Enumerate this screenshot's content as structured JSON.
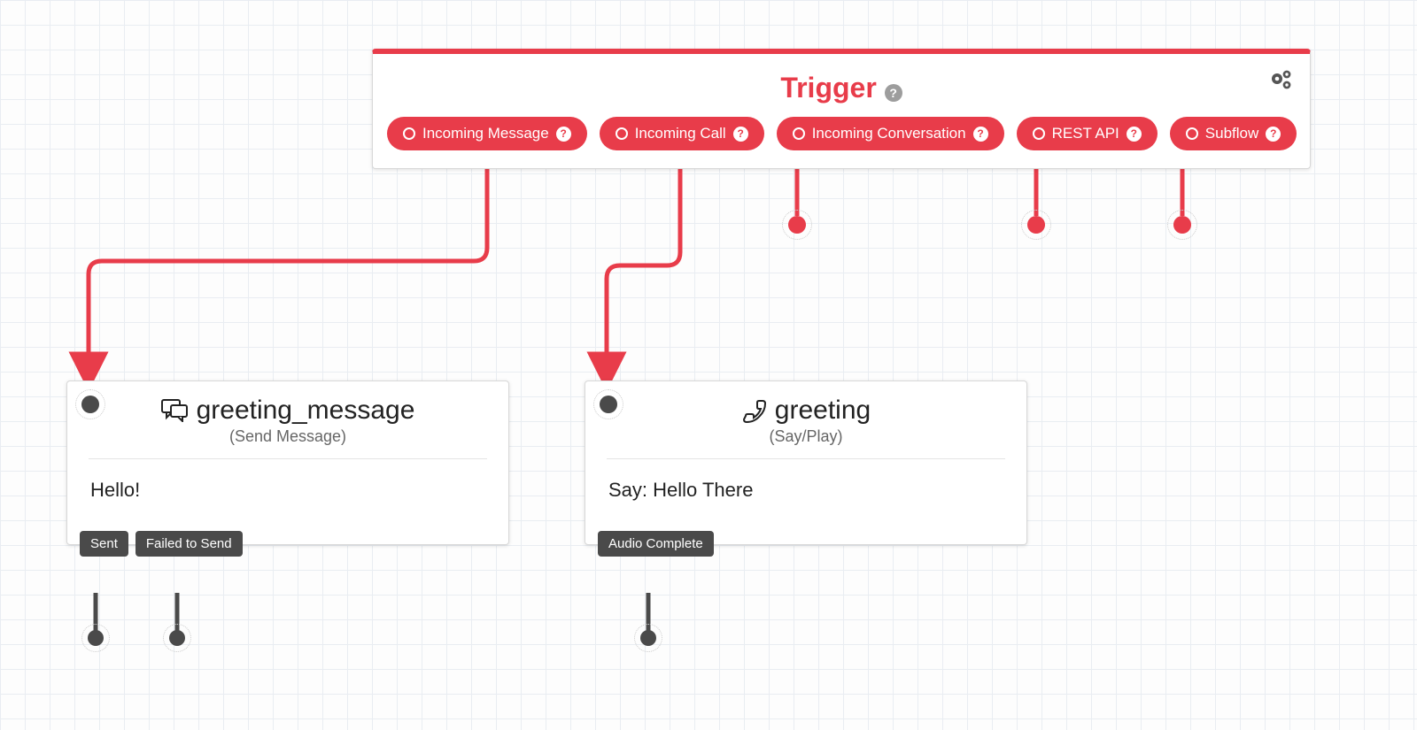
{
  "colors": {
    "accent": "#e83c4a",
    "dark": "#4a4a4a"
  },
  "trigger": {
    "title": "Trigger",
    "pills": {
      "incoming_message": "Incoming Message",
      "incoming_call": "Incoming Call",
      "incoming_conversation": "Incoming Conversation",
      "rest_api": "REST API",
      "subflow": "Subflow"
    }
  },
  "steps": {
    "greeting_message": {
      "title": "greeting_message",
      "subtitle": "(Send Message)",
      "body": "Hello!",
      "outputs": {
        "sent": "Sent",
        "failed": "Failed to Send"
      }
    },
    "greeting": {
      "title": "greeting",
      "subtitle": "(Say/Play)",
      "body": "Say: Hello There",
      "outputs": {
        "audio_complete": "Audio Complete"
      }
    }
  }
}
